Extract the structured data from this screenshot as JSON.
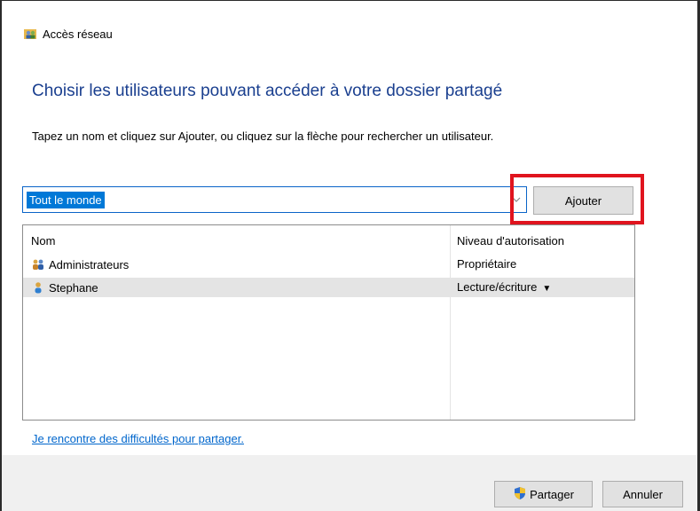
{
  "window": {
    "title": "Accès réseau",
    "icon": "network-users-icon"
  },
  "heading": "Choisir les utilisateurs pouvant accéder à votre dossier partagé",
  "instruction": "Tapez un nom et cliquez sur Ajouter, ou cliquez sur la flèche pour rechercher un utilisateur.",
  "user_input": {
    "value": "Tout le monde",
    "dropdown_icon": "chevron-down-icon"
  },
  "add_button": {
    "label": "Ajouter"
  },
  "table": {
    "columns": [
      "Nom",
      "Niveau d'autorisation"
    ],
    "rows": [
      {
        "name": "Administrateurs",
        "level": "Propriétaire",
        "icon": "group-users-icon",
        "selected": false
      },
      {
        "name": "Stephane",
        "level": "Lecture/écriture",
        "icon": "user-icon",
        "selected": true,
        "has_dropdown": true
      }
    ]
  },
  "help_link": "Je rencontre des difficultés pour partager.",
  "footer": {
    "share_label": "Partager",
    "share_icon": "shield-icon",
    "cancel_label": "Annuler"
  },
  "colors": {
    "heading": "#1a3f8f",
    "selection": "#0078d7",
    "highlight": "#e0141e",
    "link": "#0066cc"
  }
}
